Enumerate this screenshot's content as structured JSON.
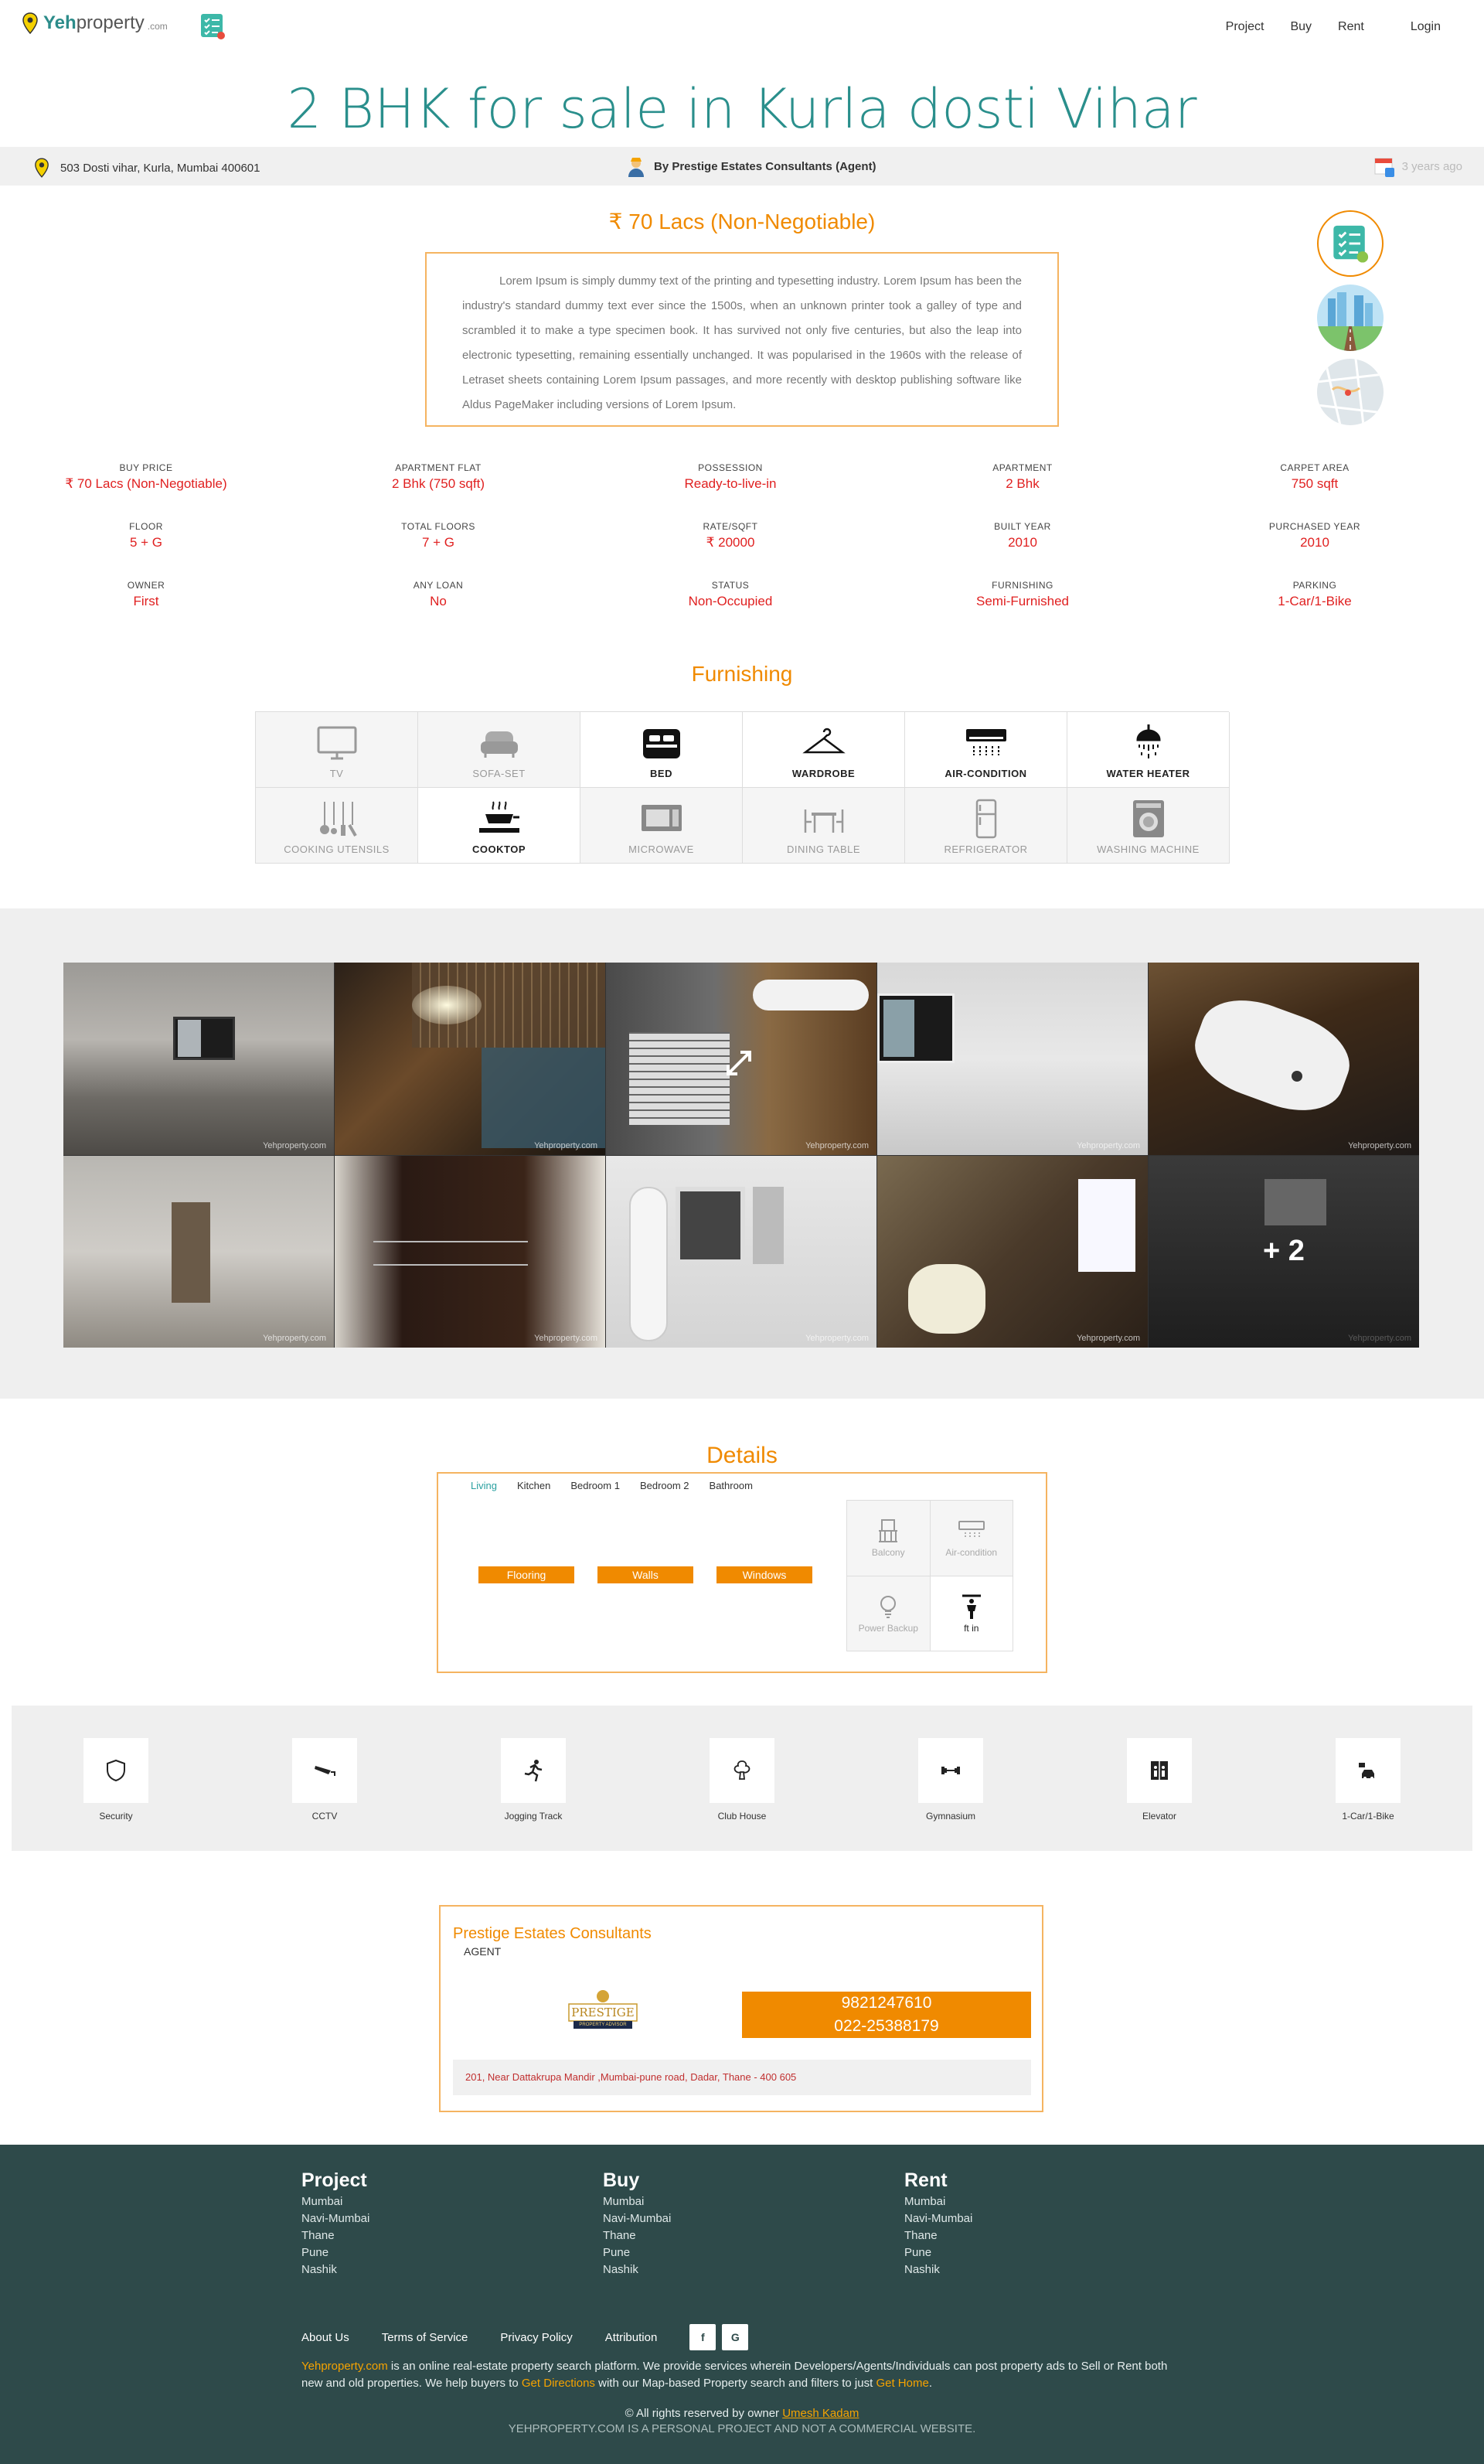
{
  "nav": {
    "logo_main": "Yeh",
    "logo_rest": "property",
    "logo_com": ".com",
    "links": [
      "Project",
      "Buy",
      "Rent"
    ],
    "login": "Login"
  },
  "title": "2 BHK for sale in Kurla dosti Vihar",
  "infobar": {
    "address": "503 Dosti vihar, Kurla, Mumbai 400601",
    "agent": "By Prestige Estates Consultants (Agent)",
    "posted": "3 years ago"
  },
  "price": "₹  70 Lacs (Non-Negotiable)",
  "description": "Lorem Ipsum is simply dummy text of the printing and typesetting industry. Lorem Ipsum has been the industry's standard dummy text ever since the 1500s, when an unknown printer took a galley of type and scrambled it to make a type specimen book. It has survived not only five centuries, but also the leap into electronic typesetting, remaining essentially unchanged. It was popularised in the 1960s with the release of Letraset sheets containing Lorem Ipsum passages, and more recently with desktop publishing software like Aldus PageMaker including versions of Lorem Ipsum.",
  "specs": [
    [
      {
        "label": "BUY PRICE",
        "value": "₹  70 Lacs (Non-Negotiable)"
      },
      {
        "label": "APARTMENT FLAT",
        "value": "2 Bhk (750 sqft)"
      },
      {
        "label": "POSSESSION",
        "value": "Ready-to-live-in"
      },
      {
        "label": "APARTMENT",
        "value": "2 Bhk"
      },
      {
        "label": "CARPET AREA",
        "value": "750 sqft"
      }
    ],
    [
      {
        "label": "FLOOR",
        "value": "5 + G"
      },
      {
        "label": "TOTAL FLOORS",
        "value": "7 + G"
      },
      {
        "label": "RATE/SQFT",
        "value": "₹ 20000"
      },
      {
        "label": "BUILT YEAR",
        "value": "2010"
      },
      {
        "label": "PURCHASED YEAR",
        "value": "2010"
      }
    ],
    [
      {
        "label": "OWNER",
        "value": "First"
      },
      {
        "label": "ANY LOAN",
        "value": "No"
      },
      {
        "label": "STATUS",
        "value": "Non-Occupied"
      },
      {
        "label": "FURNISHING",
        "value": "Semi-Furnished"
      },
      {
        "label": "PARKING",
        "value": "1-Car/1-Bike"
      }
    ]
  ],
  "furnishing": {
    "title": "Furnishing",
    "items": [
      {
        "label": "TV",
        "icon": "tv-icon",
        "active": false
      },
      {
        "label": "SOFA-SET",
        "icon": "sofa-icon",
        "active": false
      },
      {
        "label": "BED",
        "icon": "bed-icon",
        "active": true
      },
      {
        "label": "WARDROBE",
        "icon": "hanger-icon",
        "active": true
      },
      {
        "label": "AIR-CONDITION",
        "icon": "ac-icon",
        "active": true
      },
      {
        "label": "WATER HEATER",
        "icon": "shower-icon",
        "active": true
      },
      {
        "label": "COOKING UTENSILS",
        "icon": "utensils-icon",
        "active": false
      },
      {
        "label": "COOKTOP",
        "icon": "cooktop-icon",
        "active": true
      },
      {
        "label": "MICROWAVE",
        "icon": "microwave-icon",
        "active": false
      },
      {
        "label": "DINING TABLE",
        "icon": "dining-table-icon",
        "active": false
      },
      {
        "label": "REFRIGERATOR",
        "icon": "fridge-icon",
        "active": false
      },
      {
        "label": "WASHING MACHINE",
        "icon": "washing-machine-icon",
        "active": false
      }
    ]
  },
  "gallery": {
    "watermark": "Yehproperty.com",
    "more": "+ 2"
  },
  "details": {
    "title": "Details",
    "tabs": [
      "Living",
      "Kitchen",
      "Bedroom 1",
      "Bedroom 2",
      "Bathroom"
    ],
    "buttons": [
      "Flooring",
      "Walls",
      "Windows"
    ],
    "features": [
      {
        "label": "Balcony",
        "icon": "balcony-icon",
        "active": false
      },
      {
        "label": "Air-condition",
        "icon": "ac-icon",
        "active": false
      },
      {
        "label": "Power Backup",
        "icon": "bulb-icon",
        "active": false
      },
      {
        "label": "ft in",
        "icon": "height-icon",
        "active": true
      }
    ]
  },
  "amenities": [
    {
      "label": "Security",
      "icon": "shield-icon"
    },
    {
      "label": "CCTV",
      "icon": "cctv-icon"
    },
    {
      "label": "Jogging Track",
      "icon": "runner-icon"
    },
    {
      "label": "Club House",
      "icon": "club-house-icon"
    },
    {
      "label": "Gymnasium",
      "icon": "dumbbell-icon"
    },
    {
      "label": "Elevator",
      "icon": "elevator-icon"
    },
    {
      "label": "1-Car/1-Bike",
      "icon": "car-bike-icon"
    }
  ],
  "agent_card": {
    "name": "Prestige Estates Consultants",
    "role": "AGENT",
    "logo_text": "PRESTIGE",
    "logo_sub": "PROPERTY ADVISOR",
    "phone1": "9821247610",
    "phone2": "022-25388179",
    "address": "201, Near Dattakrupa Mandir ,Mumbai-pune road, Dadar, Thane - 400 605"
  },
  "footer": {
    "columns": [
      {
        "title": "Project",
        "items": [
          "Mumbai",
          "Navi-Mumbai",
          "Thane",
          "Pune",
          "Nashik"
        ]
      },
      {
        "title": "Buy",
        "items": [
          "Mumbai",
          "Navi-Mumbai",
          "Thane",
          "Pune",
          "Nashik"
        ]
      },
      {
        "title": "Rent",
        "items": [
          "Mumbai",
          "Navi-Mumbai",
          "Thane",
          "Pune",
          "Nashik"
        ]
      }
    ],
    "links": [
      "About Us",
      "Terms of Service",
      "Privacy Policy",
      "Attribution"
    ],
    "social": [
      "f",
      "G"
    ],
    "brand": "Yehproperty.com",
    "text1": " is an online real-estate property search platform. We provide services wherein Developers/Agents/Individuals can post property ads to Sell or Rent both new and old properties. We help buyers to ",
    "get_directions": "Get Directions",
    "text2": " with our Map-based Property search and filters to just ",
    "get_home": "Get Home",
    "text3": ".",
    "copyright": "© All rights reserved by owner ",
    "owner": "Umesh Kadam",
    "personal": "YEHPROPERTY.COM IS A PERSONAL PROJECT AND NOT A COMMERCIAL WEBSITE."
  },
  "colors": {
    "accent": "#f08a00",
    "teal": "#2a8f8c",
    "footer": "#2e4a4a",
    "value_red": "#e02020"
  }
}
